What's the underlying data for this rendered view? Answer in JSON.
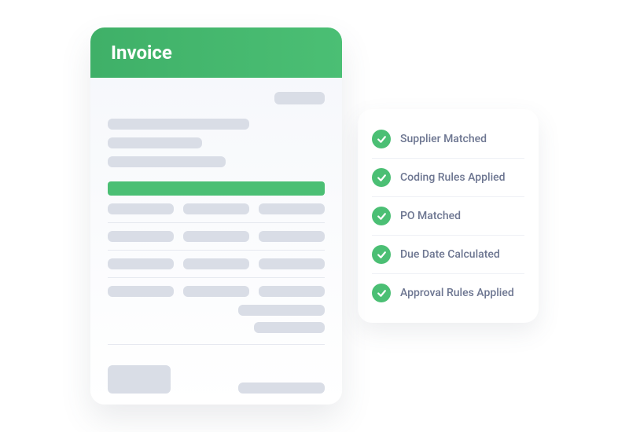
{
  "invoice": {
    "title": "Invoice"
  },
  "checks": [
    {
      "label": "Supplier Matched"
    },
    {
      "label": "Coding Rules Applied"
    },
    {
      "label": "PO Matched"
    },
    {
      "label": "Due Date Calculated"
    },
    {
      "label": "Approval Rules Applied"
    }
  ]
}
